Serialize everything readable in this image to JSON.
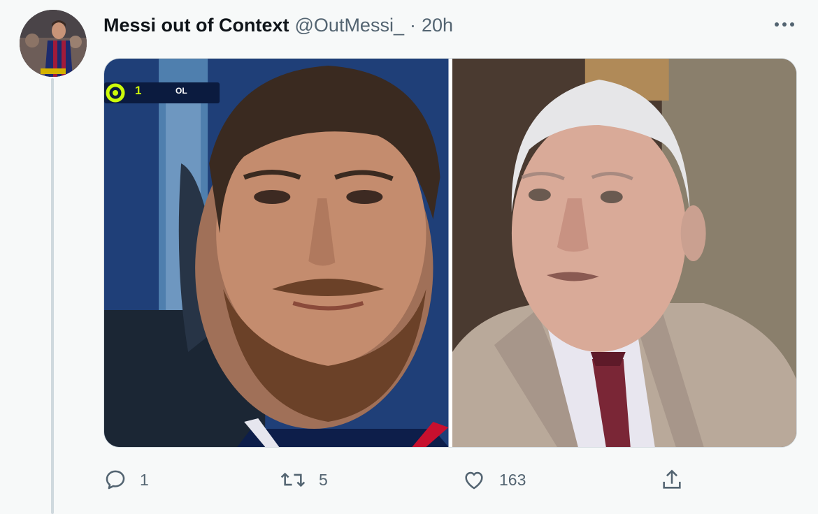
{
  "tweet": {
    "author": {
      "display_name": "Messi out of Context",
      "handle": "@OutMessi_",
      "avatar_icon": "profile-avatar-player-photo"
    },
    "separator": "·",
    "time": "20h",
    "more_icon": "more-horizontal-icon",
    "media": [
      {
        "icon": "bearded-footballer-photo",
        "overlay": {
          "score": "1",
          "team": "OL",
          "league_icon": "ligue1-logo-icon"
        }
      },
      {
        "icon": "older-man-in-suit-photo"
      }
    ],
    "actions": {
      "reply": {
        "icon": "reply-icon",
        "count": "1"
      },
      "retweet": {
        "icon": "retweet-icon",
        "count": "5"
      },
      "like": {
        "icon": "heart-icon",
        "count": "163"
      },
      "share": {
        "icon": "share-icon"
      }
    },
    "colors": {
      "text_primary": "#0f1419",
      "text_secondary": "#536471",
      "background": "#f7f9f9",
      "league_green": "#cdfb0a"
    }
  }
}
